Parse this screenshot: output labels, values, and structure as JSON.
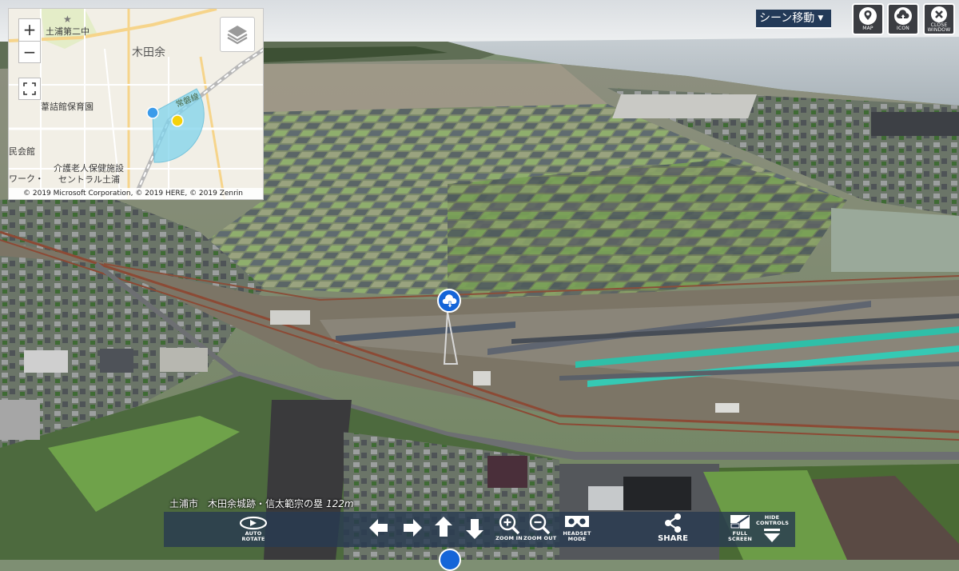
{
  "minimap": {
    "zoom_in": "+",
    "zoom_out": "−",
    "labels": {
      "school": "土浦第二中",
      "area": "木田余",
      "route": "常磐線",
      "nursery": "葦詰館保育園",
      "hall": "民会館",
      "facility_line1": "介護老人保健施設",
      "facility_line2": "セントラル土浦",
      "work": "ワーク・"
    },
    "copyright": "© 2019 Microsoft Corporation, © 2019 HERE, © 2019 Zenrin",
    "colors": {
      "fov": "#7fd3ec",
      "marker_blue": "#3b9bea",
      "marker_yellow": "#f5d20a"
    }
  },
  "header": {
    "scene_move": "シーン移動",
    "buttons": [
      {
        "id": "map",
        "label": "MAP"
      },
      {
        "id": "icon",
        "label": "ICON"
      },
      {
        "id": "close",
        "label_line1": "CLOSE",
        "label_line2": "WINDOW"
      }
    ]
  },
  "location": {
    "name": "土浦市　木田余城跡・信太範宗の塁",
    "height": "122m"
  },
  "controls": {
    "auto_rotate_line1": "AUTO",
    "auto_rotate_line2": "ROTATE",
    "zoom_in": "ZOOM IN",
    "zoom_out": "ZOOM OUT",
    "headset_line1": "HEADSET",
    "headset_line2": "MODE",
    "share": "SHARE",
    "full_screen_line1": "FULL",
    "full_screen_line2": "SCREEN",
    "hide_controls_line1": "HIDE",
    "hide_controls_line2": "CONTROLS"
  },
  "colors": {
    "control_bar": "#283a50",
    "hotspot": "#1565d8",
    "scene_move_bg": "#233a58"
  }
}
